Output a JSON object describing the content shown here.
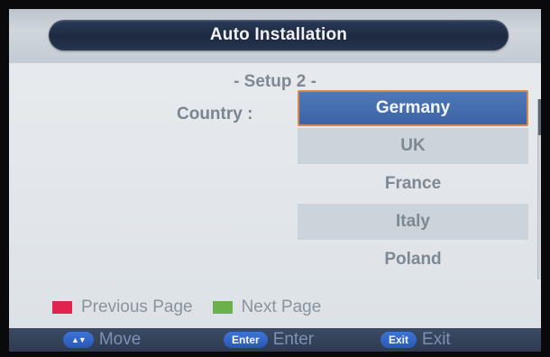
{
  "window": {
    "title": "Auto Installation",
    "subtitle": "- Setup 2 -"
  },
  "country": {
    "label": "Country :",
    "selected": "Germany",
    "options": [
      "Germany",
      "UK",
      "France",
      "Italy",
      "Poland"
    ]
  },
  "scroll": {
    "position_fraction": 0.0
  },
  "page_hints": {
    "previous": "Previous Page",
    "next": "Next Page",
    "previous_color": "#e0244f",
    "next_color": "#6ab04c"
  },
  "bottom_bar": {
    "move_key_glyph": "▲▼",
    "move_label": "Move",
    "enter_key": "Enter",
    "enter_label": "Enter",
    "exit_key": "Exit",
    "exit_label": "Exit"
  },
  "colors": {
    "title_bar": "#1c2940",
    "selection": "#3b63a6",
    "selection_border": "#d58a4d",
    "bottom_bar": "#2e3b52"
  }
}
